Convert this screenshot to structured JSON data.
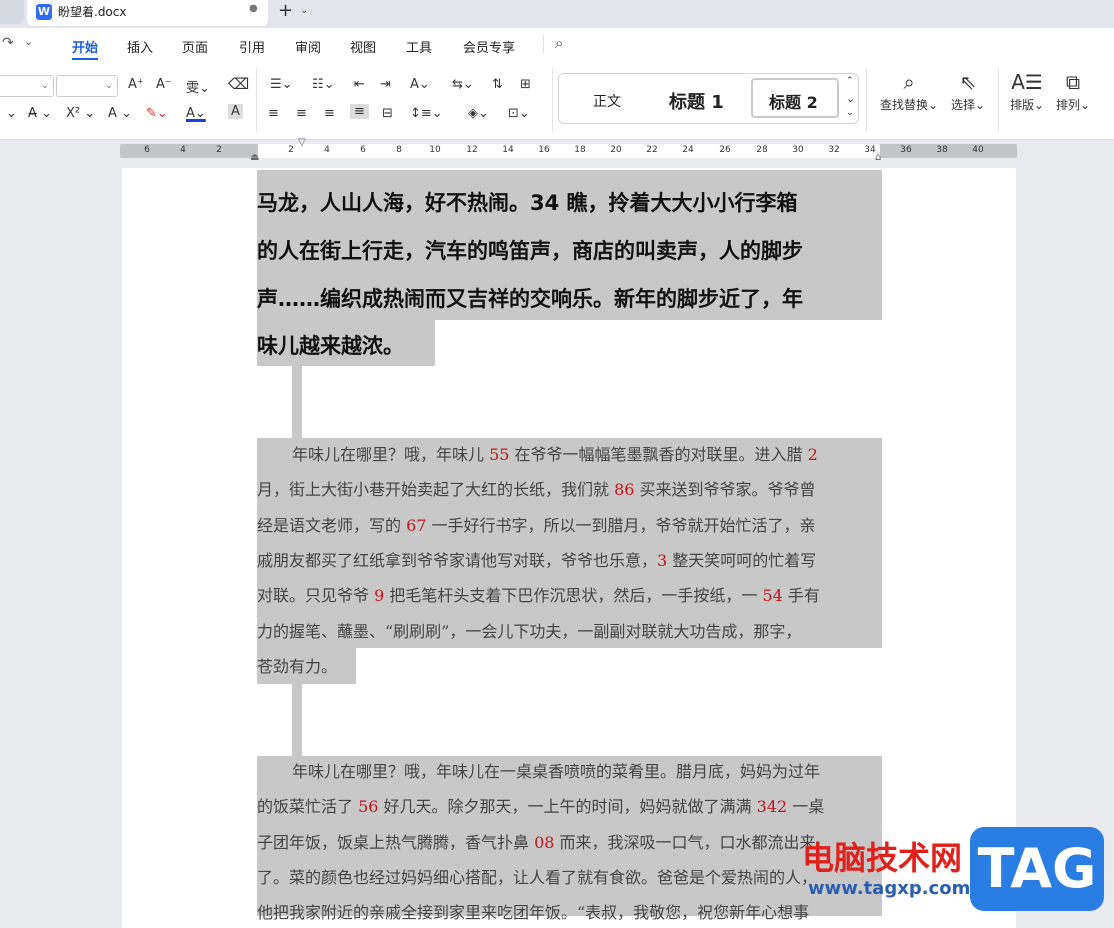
{
  "tab": {
    "filename": "盼望着.docx",
    "icon": "W"
  },
  "menu": [
    "开始",
    "插入",
    "页面",
    "引用",
    "审阅",
    "视图",
    "工具",
    "会员专享"
  ],
  "styles": {
    "normal": "正文",
    "h1": "标题 1",
    "h2": "标题 2"
  },
  "tools": {
    "find": "查找替换",
    "select": "选择",
    "layout": "排版",
    "arrange": "排列"
  },
  "ruler": {
    "ticks": [
      "6",
      "4",
      "2",
      "2",
      "4",
      "6",
      "8",
      "10",
      "12",
      "14",
      "16",
      "18",
      "20",
      "22",
      "24",
      "26",
      "28",
      "30",
      "32",
      "34",
      "36",
      "38",
      "40"
    ]
  },
  "heading": {
    "lines": [
      "马龙，人山人海，好不热闹。34 瞧，拎着大大小小行李箱",
      "的人在街上行走，汽车的鸣笛声，商店的叫卖声，人的脚步",
      "声……编织成热闹而又吉祥的交响乐。新年的脚步近了，年",
      "味儿越来越浓。"
    ]
  },
  "para1": {
    "lines": [
      [
        {
          "t": "年味儿在哪里？哦，年味儿 "
        },
        {
          "t": "55",
          "r": 1
        },
        {
          "t": " 在爷爷一幅幅笔墨飘香的对联里。进入腊 "
        },
        {
          "t": "2",
          "r": 1
        }
      ],
      [
        {
          "t": "月，街上大街小巷开始卖起了大红的长纸，我们就 "
        },
        {
          "t": "86",
          "r": 1
        },
        {
          "t": " 买来送到爷爷家。爷爷曾"
        }
      ],
      [
        {
          "t": "经是语文老师，写的 "
        },
        {
          "t": "67",
          "r": 1
        },
        {
          "t": " 一手好行书字，所以一到腊月，爷爷就开始忙活了，亲"
        }
      ],
      [
        {
          "t": "戚朋友都买了红纸拿到爷爷家请他写对联，爷爷也乐意，"
        },
        {
          "t": "3",
          "r": 1
        },
        {
          "t": " 整天笑呵呵的忙着写"
        }
      ],
      [
        {
          "t": "对联。只见爷爷 "
        },
        {
          "t": "9",
          "r": 1
        },
        {
          "t": " 把毛笔杆头支着下巴作沉思状，然后，一手按纸，一 "
        },
        {
          "t": "54",
          "r": 1
        },
        {
          "t": " 手有"
        }
      ],
      [
        {
          "t": "力的握笔、蘸墨、“刷刷刷”，一会儿下功夫，一副副对联就大功告成，那字，"
        }
      ],
      [
        {
          "t": "苍劲有力。"
        }
      ]
    ]
  },
  "para2": {
    "lines": [
      [
        {
          "t": "年味儿在哪里？哦，年味儿在一桌桌香喷喷的菜肴里。腊月底，妈妈为过年"
        }
      ],
      [
        {
          "t": "的饭菜忙活了 "
        },
        {
          "t": "56",
          "r": 1
        },
        {
          "t": " 好几天。除夕那天，一上午的时间，妈妈就做了满满 "
        },
        {
          "t": "342",
          "r": 1
        },
        {
          "t": " 一桌"
        }
      ],
      [
        {
          "t": "子团年饭，饭桌上热气腾腾，香气扑鼻 "
        },
        {
          "t": "08",
          "r": 1
        },
        {
          "t": " 而来，我深吸一口气，口水都流出来"
        }
      ],
      [
        {
          "t": "了。菜的颜色也经过妈妈细心搭配，让人看了就有食欲。爸爸是个爱热闹的人，"
        }
      ],
      [
        {
          "t": "他把我家附近的亲戚全接到家里来吃团年饭。“表叔，我敬您，祝您新年心想事"
        }
      ]
    ]
  },
  "watermark": {
    "text": "电脑技术网",
    "url": "www.tagxp.com",
    "tag": "TAG"
  }
}
